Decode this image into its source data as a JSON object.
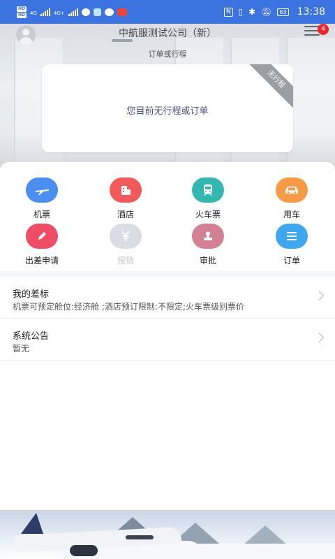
{
  "status_bar": {
    "hd1": "HD",
    "hd2": "HD",
    "net1": "4G",
    "net2": "4G+",
    "nfc": "N",
    "battery": "63",
    "time": "13:38"
  },
  "header": {
    "company": "中航服测试公司（新）",
    "notification_count": "4",
    "section_label": "订单或行程"
  },
  "trip_card": {
    "empty_text": "您目前无行程或订单",
    "ribbon": "无行程"
  },
  "grid": [
    {
      "label": "机票",
      "icon": "airplane-icon",
      "color": "#4a8ef0",
      "disabled": false
    },
    {
      "label": "酒店",
      "icon": "hotel-icon",
      "color": "#f25a5a",
      "disabled": false
    },
    {
      "label": "火车票",
      "icon": "train-icon",
      "color": "#33b8b1",
      "disabled": false
    },
    {
      "label": "用车",
      "icon": "car-icon",
      "color": "#f79a45",
      "disabled": false
    },
    {
      "label": "出差申请",
      "icon": "pencil-icon",
      "color": "#ee4d65",
      "disabled": false
    },
    {
      "label": "报销",
      "icon": "yen-icon",
      "color": "#d9dde3",
      "disabled": true
    },
    {
      "label": "审批",
      "icon": "stamp-icon",
      "color": "#d37f96",
      "disabled": false
    },
    {
      "label": "订单",
      "icon": "list-icon",
      "color": "#3fa6f0",
      "disabled": false
    }
  ],
  "travel_standard": {
    "title": "我的差标",
    "detail": "机票可预定舱位:经济舱 ;酒店预订限制:不限定;火车票级别票价"
  },
  "announcement": {
    "title": "系统公告",
    "detail": "暂无"
  }
}
